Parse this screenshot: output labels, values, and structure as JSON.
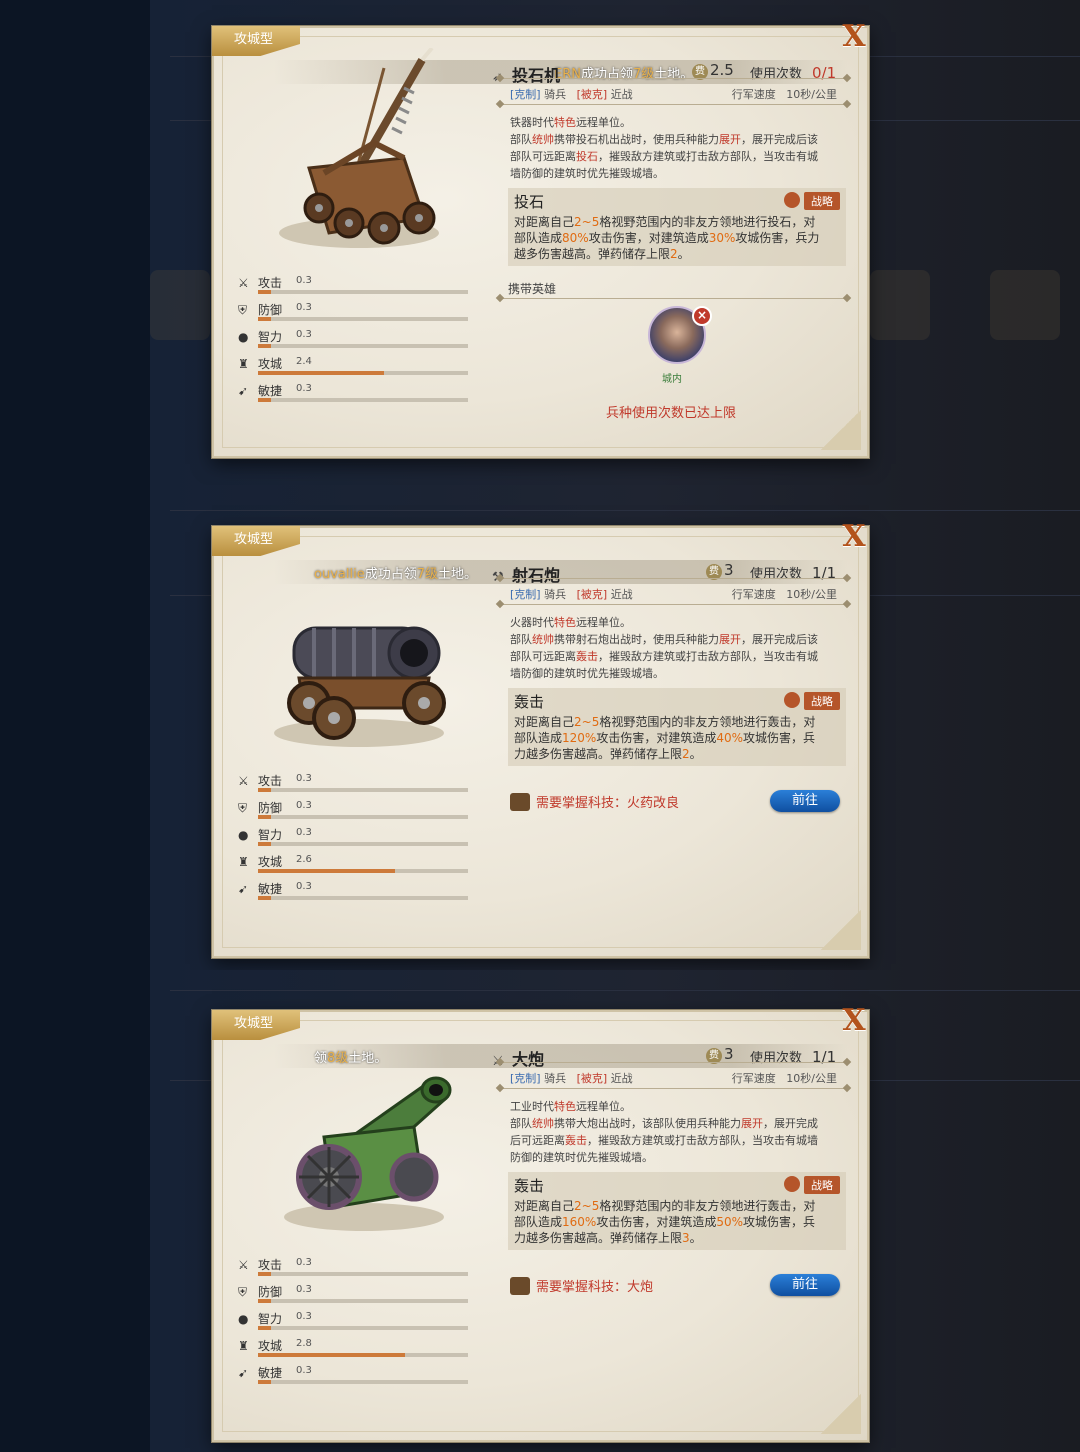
{
  "panels": [
    {
      "type_tag": "攻城型",
      "close": "X",
      "ticker_pre": "",
      "ticker_name": "ERN",
      "ticker_mid": "成功占领",
      "ticker_lv": "7级",
      "ticker_post": "土地。",
      "unit_name": "投石机",
      "cost": "2.5",
      "uses_label": "使用次数",
      "uses_value": "0/1",
      "uses_exhausted": true,
      "counter_label": "[克制]",
      "counter_value": "骑兵",
      "weak_label": "[被克]",
      "weak_value": "近战",
      "speed_label": "行军速度",
      "speed_value": "10秒/公里",
      "desc_lines": [
        [
          {
            "t": "铁器时代"
          },
          {
            "t": "特色",
            "c": "r"
          },
          {
            "t": "远程单位。"
          }
        ],
        [
          {
            "t": "部队"
          },
          {
            "t": "统帅",
            "c": "r"
          },
          {
            "t": "携带投石机出战时，使用兵种能力"
          },
          {
            "t": "展开",
            "c": "r"
          },
          {
            "t": "，展开完成后该"
          }
        ],
        [
          {
            "t": "部队可远距离"
          },
          {
            "t": "投石",
            "c": "r"
          },
          {
            "t": "，摧毁敌方建筑或打击敌方部队，当攻击有城"
          }
        ],
        [
          {
            "t": "墙防御的建筑时优先摧毁城墙。"
          }
        ]
      ],
      "skill_name": "投石",
      "skill_tag": "战略",
      "skill_lines": [
        [
          {
            "t": "对距离自己"
          },
          {
            "t": "2~5",
            "c": "o"
          },
          {
            "t": "格视野范围内的非友方领地进行投石，对"
          }
        ],
        [
          {
            "t": "部队造成"
          },
          {
            "t": "80%",
            "c": "o"
          },
          {
            "t": "攻击伤害，对建筑造成"
          },
          {
            "t": "30%",
            "c": "o"
          },
          {
            "t": "攻城伤害，兵力"
          }
        ],
        [
          {
            "t": "越多伤害越高。弹药储存上限"
          },
          {
            "t": "2",
            "c": "o"
          },
          {
            "t": "。"
          }
        ]
      ],
      "hero_section": "携带英雄",
      "hero_location": "城内",
      "limit_text": "兵种使用次数已达上限",
      "stats": [
        {
          "label": "攻击",
          "value": "0.3",
          "level": 0.06,
          "icon": "sword-icon"
        },
        {
          "label": "防御",
          "value": "0.3",
          "level": 0.06,
          "icon": "shield-icon"
        },
        {
          "label": "智力",
          "value": "0.3",
          "level": 0.06,
          "icon": "head-icon"
        },
        {
          "label": "攻城",
          "value": "2.4",
          "level": 0.6,
          "icon": "tower-icon"
        },
        {
          "label": "敏捷",
          "value": "0.3",
          "level": 0.06,
          "icon": "boot-icon"
        }
      ]
    },
    {
      "type_tag": "攻城型",
      "close": "X",
      "ticker_pre": "",
      "ticker_name": "ouvallie",
      "ticker_mid": "成功占领",
      "ticker_lv": "7级",
      "ticker_post": "土地。",
      "unit_name": "射石炮",
      "cost": "3",
      "uses_label": "使用次数",
      "uses_value": "1/1",
      "uses_exhausted": false,
      "counter_label": "[克制]",
      "counter_value": "骑兵",
      "weak_label": "[被克]",
      "weak_value": "近战",
      "speed_label": "行军速度",
      "speed_value": "10秒/公里",
      "desc_lines": [
        [
          {
            "t": "火器时代"
          },
          {
            "t": "特色",
            "c": "r"
          },
          {
            "t": "远程单位。"
          }
        ],
        [
          {
            "t": "部队"
          },
          {
            "t": "统帅",
            "c": "r"
          },
          {
            "t": "携带射石炮出战时，使用兵种能力"
          },
          {
            "t": "展开",
            "c": "r"
          },
          {
            "t": "，展开完成后该"
          }
        ],
        [
          {
            "t": "部队可远距离"
          },
          {
            "t": "轰击",
            "c": "r"
          },
          {
            "t": "，摧毁敌方建筑或打击敌方部队，当攻击有城"
          }
        ],
        [
          {
            "t": "墙防御的建筑时优先摧毁城墙。"
          }
        ]
      ],
      "skill_name": "轰击",
      "skill_tag": "战略",
      "skill_lines": [
        [
          {
            "t": "对距离自己"
          },
          {
            "t": "2~5",
            "c": "o"
          },
          {
            "t": "格视野范围内的非友方领地进行轰击，对"
          }
        ],
        [
          {
            "t": "部队造成"
          },
          {
            "t": "120%",
            "c": "o"
          },
          {
            "t": "攻击伤害，对建筑造成"
          },
          {
            "t": "40%",
            "c": "o"
          },
          {
            "t": "攻城伤害，兵"
          }
        ],
        [
          {
            "t": "力越多伤害越高。弹药储存上限"
          },
          {
            "t": "2",
            "c": "o"
          },
          {
            "t": "。"
          }
        ]
      ],
      "tech_text": "需要掌握科技：火药改良",
      "go_label": "前往",
      "stats": [
        {
          "label": "攻击",
          "value": "0.3",
          "level": 0.06,
          "icon": "sword-icon"
        },
        {
          "label": "防御",
          "value": "0.3",
          "level": 0.06,
          "icon": "shield-icon"
        },
        {
          "label": "智力",
          "value": "0.3",
          "level": 0.06,
          "icon": "head-icon"
        },
        {
          "label": "攻城",
          "value": "2.6",
          "level": 0.65,
          "icon": "tower-icon"
        },
        {
          "label": "敏捷",
          "value": "0.3",
          "level": 0.06,
          "icon": "boot-icon"
        }
      ]
    },
    {
      "type_tag": "攻城型",
      "close": "X",
      "ticker_pre": "领",
      "ticker_name": "",
      "ticker_mid": "",
      "ticker_lv": "8级",
      "ticker_post": "土地。",
      "unit_name": "大炮",
      "cost": "3",
      "uses_label": "使用次数",
      "uses_value": "1/1",
      "uses_exhausted": false,
      "counter_label": "[克制]",
      "counter_value": "骑兵",
      "weak_label": "[被克]",
      "weak_value": "近战",
      "speed_label": "行军速度",
      "speed_value": "10秒/公里",
      "desc_lines": [
        [
          {
            "t": "工业时代"
          },
          {
            "t": "特色",
            "c": "r"
          },
          {
            "t": "远程单位。"
          }
        ],
        [
          {
            "t": "部队"
          },
          {
            "t": "统帅",
            "c": "r"
          },
          {
            "t": "携带大炮出战时，该部队使用兵种能力"
          },
          {
            "t": "展开",
            "c": "r"
          },
          {
            "t": "，展开完成"
          }
        ],
        [
          {
            "t": "后可远距离"
          },
          {
            "t": "轰击",
            "c": "r"
          },
          {
            "t": "，摧毁敌方建筑或打击敌方部队，当攻击有城墙"
          }
        ],
        [
          {
            "t": "防御的建筑时优先摧毁城墙。"
          }
        ]
      ],
      "skill_name": "轰击",
      "skill_tag": "战略",
      "skill_lines": [
        [
          {
            "t": "对距离自己"
          },
          {
            "t": "2~5",
            "c": "o"
          },
          {
            "t": "格视野范围内的非友方领地进行轰击，对"
          }
        ],
        [
          {
            "t": "部队造成"
          },
          {
            "t": "160%",
            "c": "o"
          },
          {
            "t": "攻击伤害，对建筑造成"
          },
          {
            "t": "50%",
            "c": "o"
          },
          {
            "t": "攻城伤害，兵"
          }
        ],
        [
          {
            "t": "力越多伤害越高。弹药储存上限"
          },
          {
            "t": "3",
            "c": "o"
          },
          {
            "t": "。"
          }
        ]
      ],
      "tech_text": "需要掌握科技：大炮",
      "go_label": "前往",
      "stats": [
        {
          "label": "攻击",
          "value": "0.3",
          "level": 0.06,
          "icon": "sword-icon"
        },
        {
          "label": "防御",
          "value": "0.3",
          "level": 0.06,
          "icon": "shield-icon"
        },
        {
          "label": "智力",
          "value": "0.3",
          "level": 0.06,
          "icon": "head-icon"
        },
        {
          "label": "攻城",
          "value": "2.8",
          "level": 0.7,
          "icon": "tower-icon"
        },
        {
          "label": "敏捷",
          "value": "0.3",
          "level": 0.06,
          "icon": "boot-icon"
        }
      ]
    }
  ],
  "colors": {
    "accent": "#cd7a3a",
    "counter": "#3a6bb0",
    "warning": "#c0392b",
    "highlight": "#e06b12",
    "button": "#1a63bf"
  }
}
